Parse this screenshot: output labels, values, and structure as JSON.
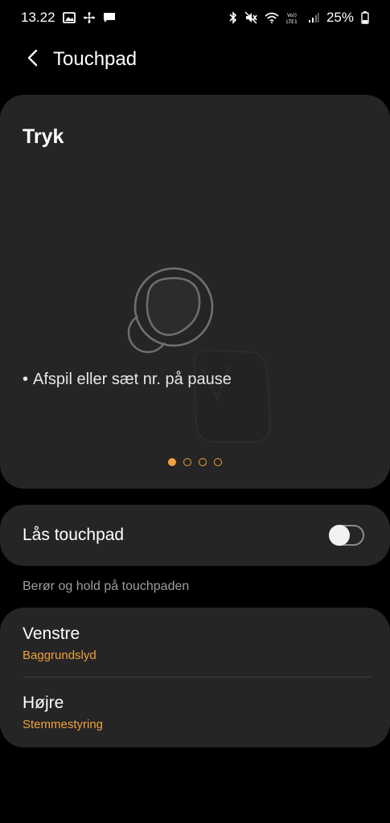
{
  "status_bar": {
    "time": "13.22",
    "battery": "25%",
    "left_icons": [
      "image-icon",
      "pinwheel-icon",
      "message-icon"
    ],
    "right_icons": [
      "bluetooth-icon",
      "mute-icon",
      "wifi-icon",
      "volte-icon",
      "signal-icon",
      "battery-icon"
    ],
    "volte_label": "Vo))\nLTE1"
  },
  "app_bar": {
    "title": "Touchpad"
  },
  "gesture_card": {
    "title": "Tryk",
    "bullet": "•",
    "description": "Afspil eller sæt nr. på pause",
    "pages": 4,
    "active_page": 1
  },
  "lock": {
    "label": "Lås touchpad",
    "enabled": false
  },
  "hold_section": {
    "header": "Berør og hold på touchpaden",
    "items": [
      {
        "title": "Venstre",
        "value": "Baggrundslyd"
      },
      {
        "title": "Højre",
        "value": "Stemmestyring"
      }
    ]
  },
  "colors": {
    "accent": "#f0a23a",
    "card_bg": "#252525",
    "background": "#000000"
  }
}
